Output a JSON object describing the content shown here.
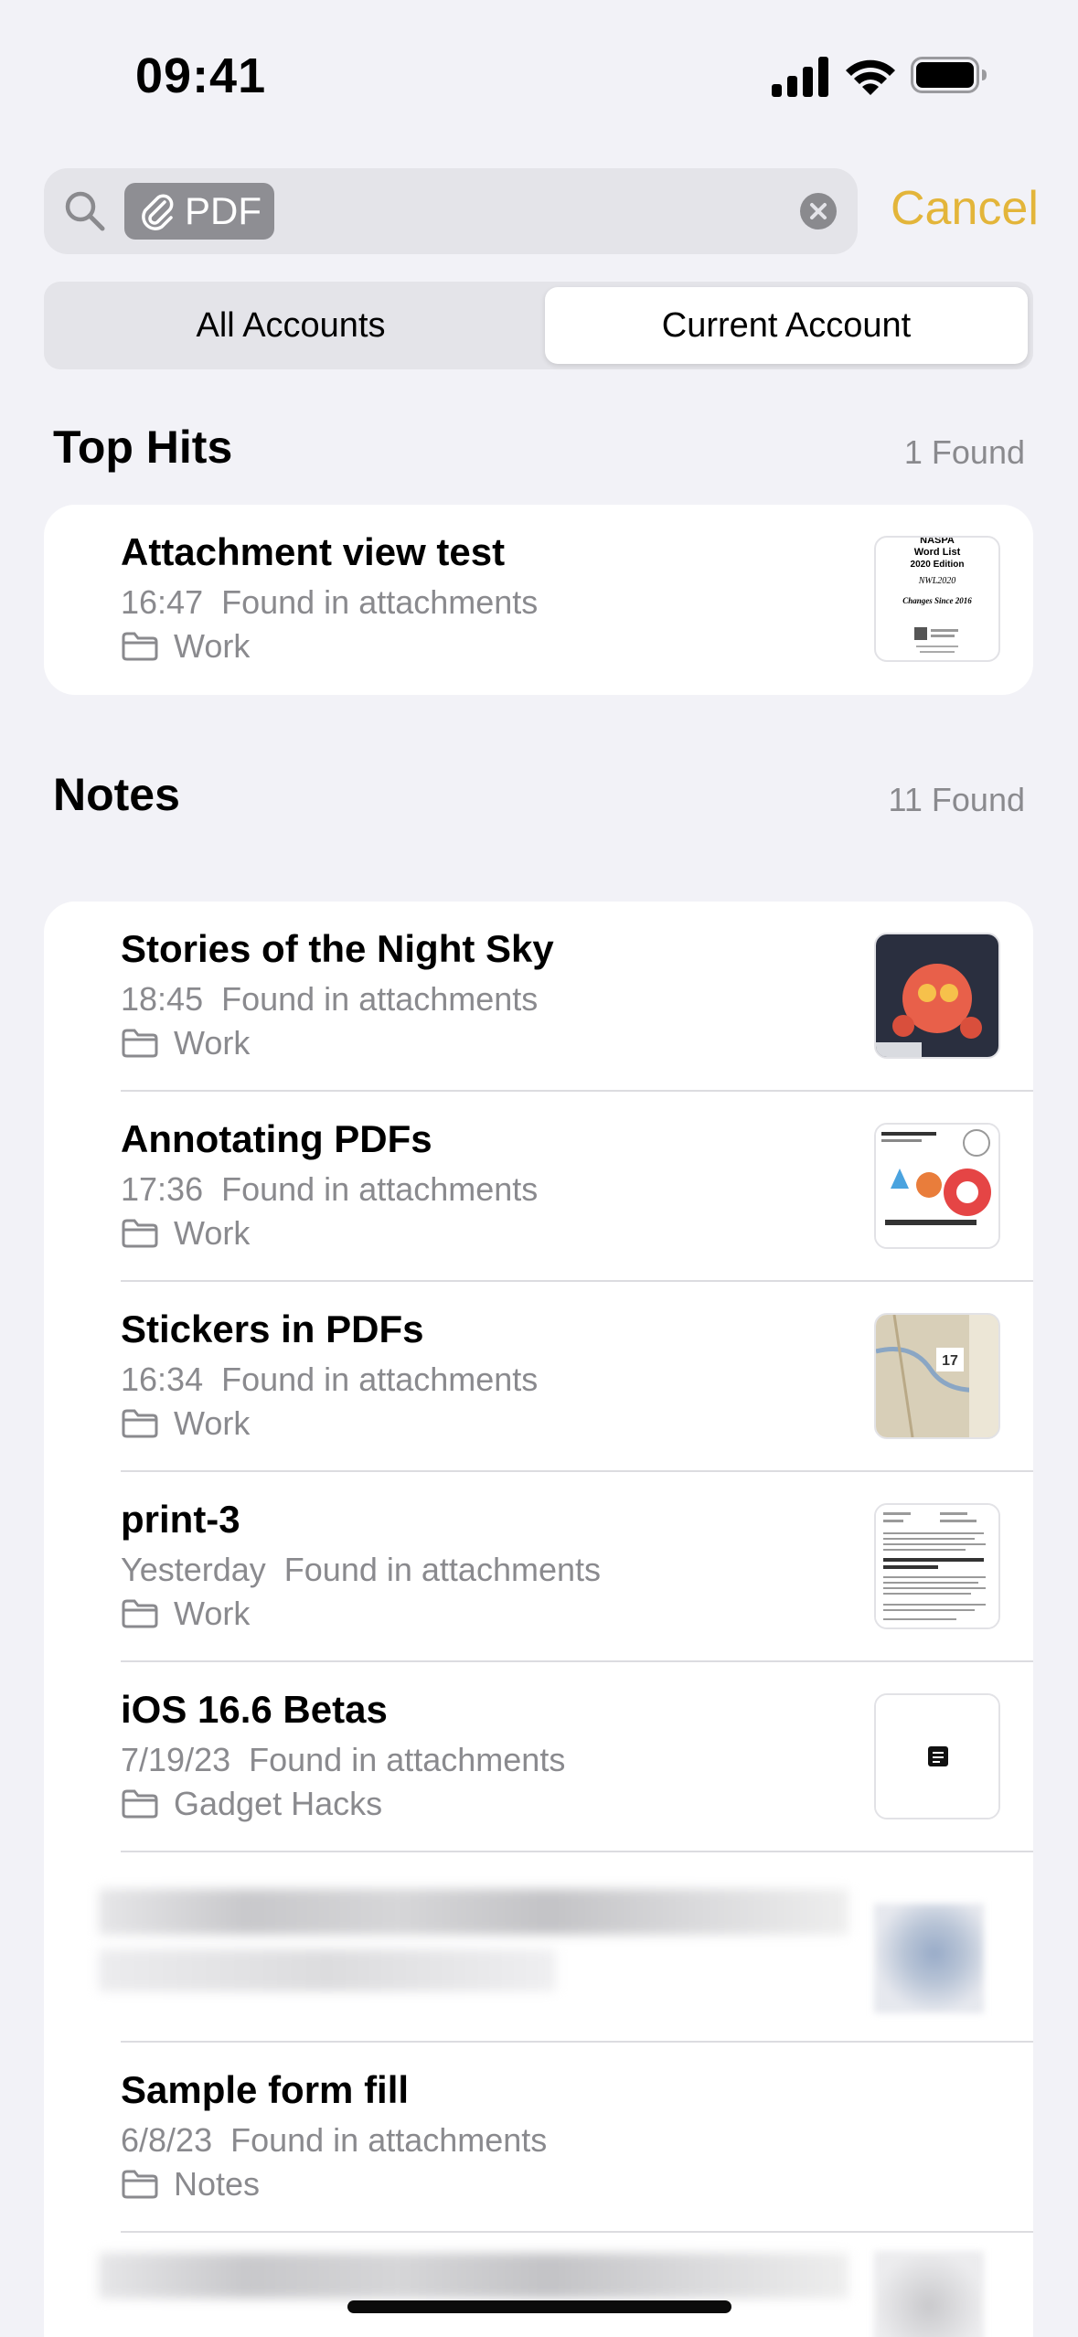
{
  "status_bar": {
    "time": "09:41"
  },
  "search": {
    "token_label": "PDF",
    "token_icon": "paperclip-icon",
    "cancel_label": "Cancel"
  },
  "scope": {
    "all_label": "All Accounts",
    "current_label": "Current Account",
    "selected": "Current Account"
  },
  "top_hits": {
    "title": "Top Hits",
    "count": "1 Found",
    "items": [
      {
        "title": "Attachment view test",
        "time": "16:47",
        "found": "Found in attachments",
        "folder": "Work"
      }
    ]
  },
  "notes": {
    "title": "Notes",
    "count": "11 Found",
    "items": [
      {
        "title": "Stories of the Night Sky",
        "time": "18:45",
        "found": "Found in attachments",
        "folder": "Work"
      },
      {
        "title": "Annotating PDFs",
        "time": "17:36",
        "found": "Found in attachments",
        "folder": "Work"
      },
      {
        "title": "Stickers in PDFs",
        "time": "16:34",
        "found": "Found in attachments",
        "folder": "Work"
      },
      {
        "title": "print-3",
        "time": "Yesterday",
        "found": "Found in attachments",
        "folder": "Work"
      },
      {
        "title": "iOS 16.6 Betas",
        "time": "7/19/23",
        "found": "Found in attachments",
        "folder": "Gadget Hacks"
      },
      {
        "title": "Sample form fill",
        "time": "6/8/23",
        "found": "Found in attachments",
        "folder": "Notes"
      }
    ]
  },
  "thumbnails": {
    "top_hit_doc_lines": [
      "NASPA",
      "Word List",
      "2020 Edition",
      "NWL2020",
      "Changes Since 2016"
    ],
    "sticker_number": "17"
  },
  "colors": {
    "accent": "#e3b53a",
    "background": "#f2f2f7",
    "secondary_text": "#8a8a8e"
  }
}
